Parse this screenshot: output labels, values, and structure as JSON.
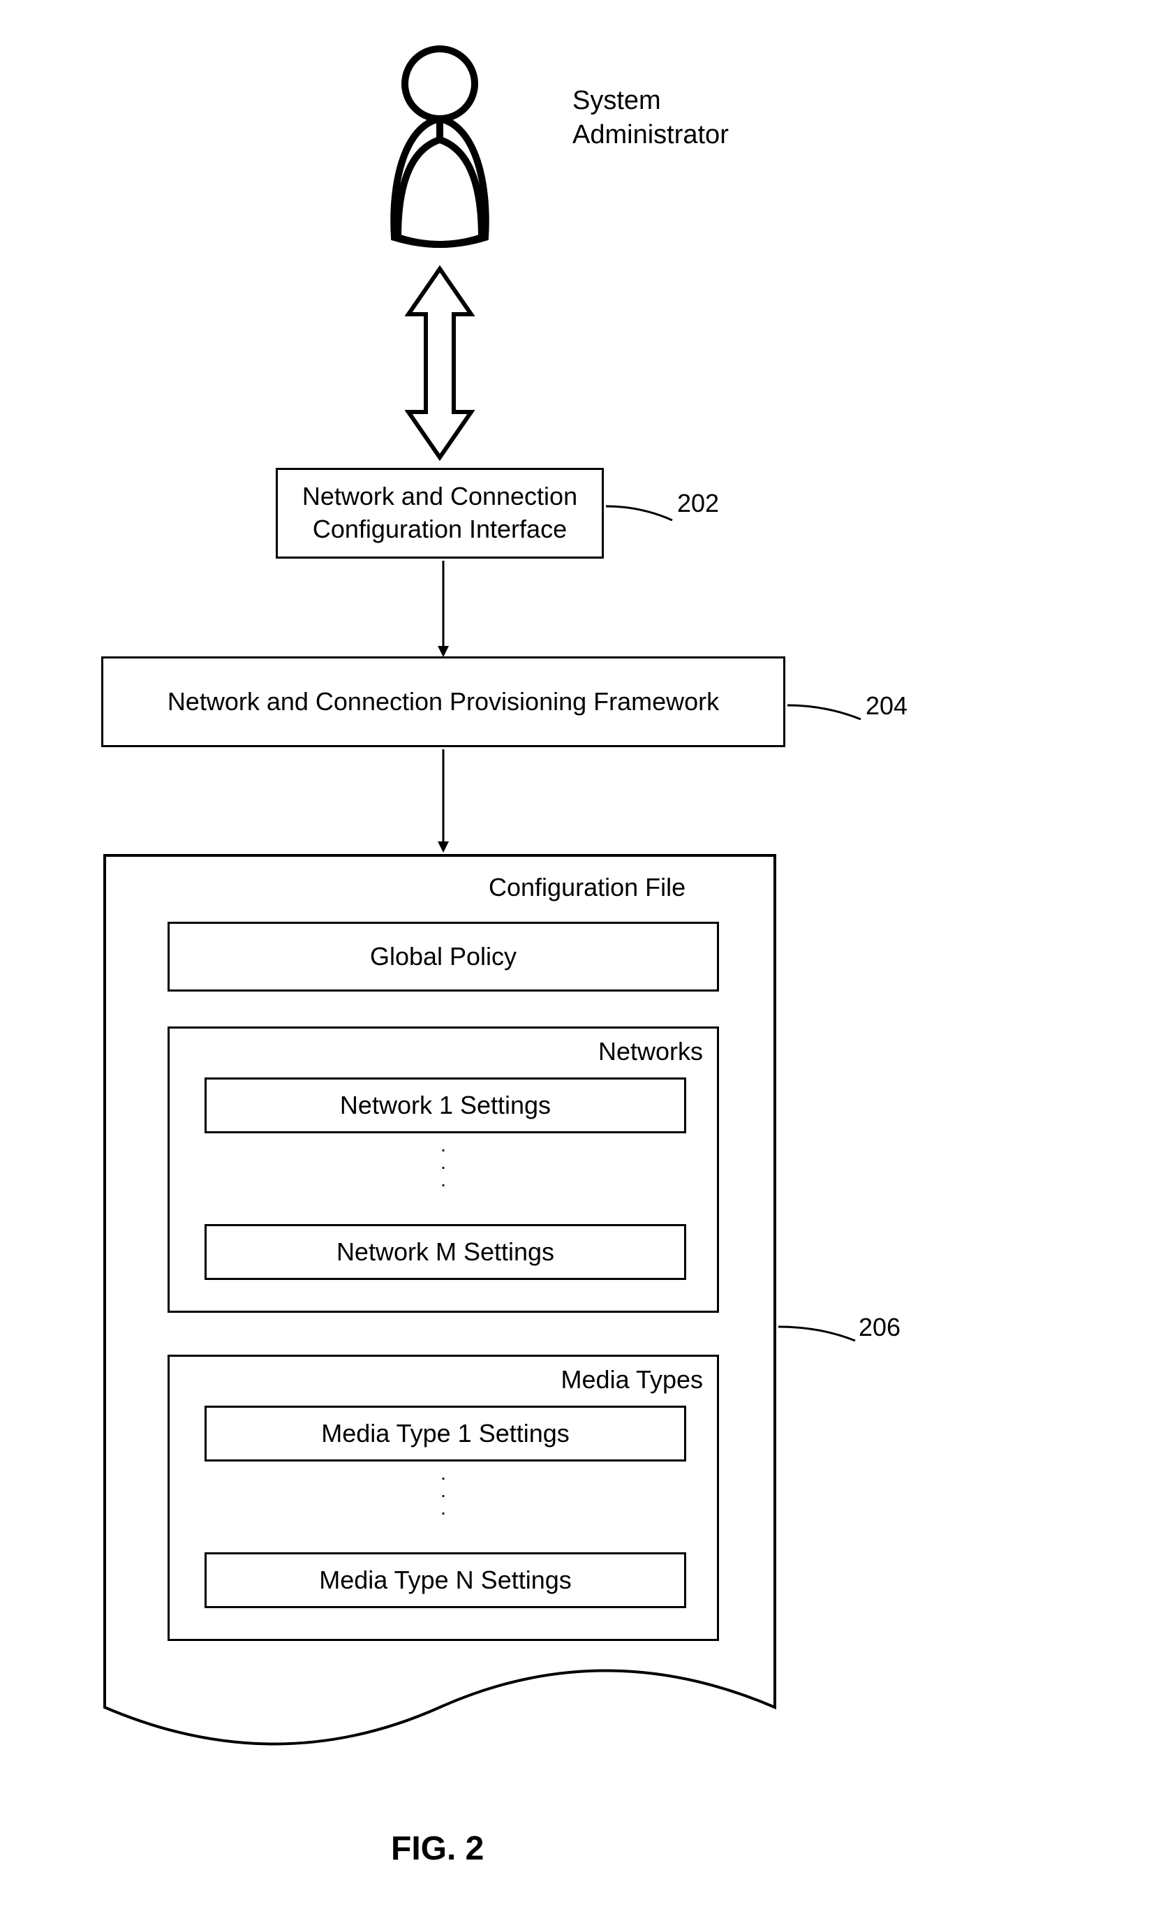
{
  "actor": {
    "label": "System\nAdministrator"
  },
  "box202": {
    "text": "Network and Connection\nConfiguration Interface",
    "ref": "202"
  },
  "box204": {
    "text": "Network and Connection Provisioning Framework",
    "ref": "204"
  },
  "doc206": {
    "title": "Configuration File",
    "ref": "206",
    "global": "Global Policy",
    "networks": {
      "title": "Networks",
      "item1": "Network 1 Settings",
      "itemM": "Network M Settings"
    },
    "media": {
      "title": "Media Types",
      "item1": "Media Type 1 Settings",
      "itemN": "Media Type N Settings"
    }
  },
  "figure": "FIG. 2"
}
